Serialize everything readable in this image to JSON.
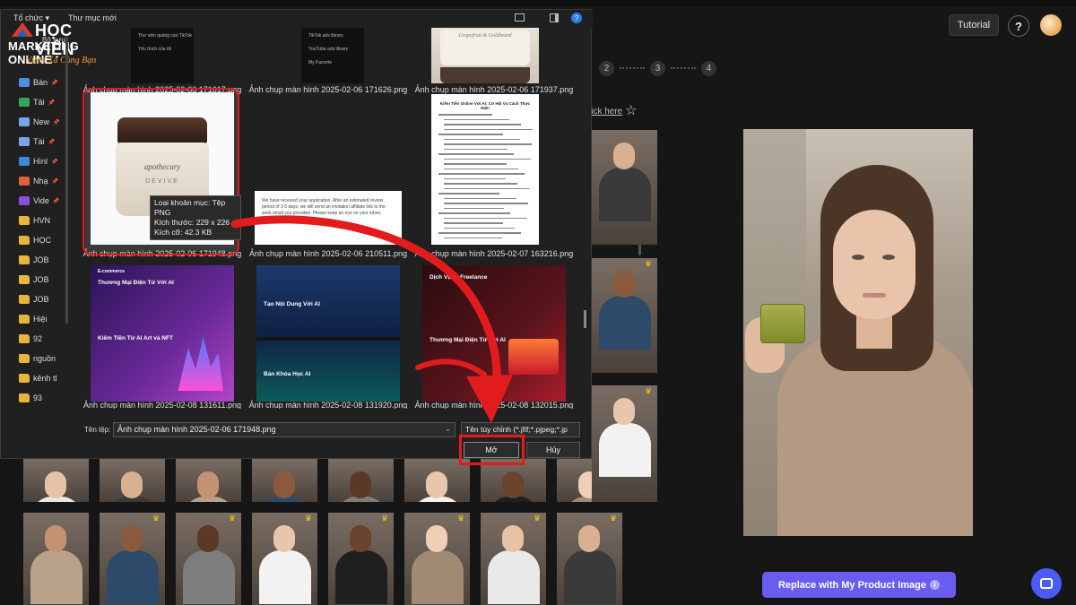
{
  "app": {
    "tutorial_label": "Tutorial",
    "help_label": "?",
    "steps": [
      "2",
      "3",
      "4"
    ],
    "click_here": "lick here",
    "replace_button": "Replace with My Product Image",
    "info_icon": "info-icon",
    "accent_color": "#6b5cf0"
  },
  "logo": {
    "hoc_vien": "HỌC VIỆN",
    "marketing": "MARKETING ONLINE",
    "slogan": "Vươn Xa Cùng Bạn",
    "sub": "Bộ sưu"
  },
  "dialog": {
    "organize": "Tổ chức ▾",
    "new_folder": "Thư mục mới",
    "nav_items": [
      {
        "label": "Bàn",
        "icon": "desktop-icon"
      },
      {
        "label": "Tải",
        "icon": "download-icon"
      },
      {
        "label": "New",
        "icon": "document-icon"
      },
      {
        "label": "Tài",
        "icon": "document-icon"
      },
      {
        "label": "Hìnl",
        "icon": "picture-icon"
      },
      {
        "label": "Nhạ",
        "icon": "music-icon"
      },
      {
        "label": "Vide",
        "icon": "video-icon"
      },
      {
        "label": "HVN",
        "icon": "folder-icon"
      },
      {
        "label": "HỌC",
        "icon": "folder-icon"
      },
      {
        "label": "JOB",
        "icon": "folder-icon"
      },
      {
        "label": "JOB",
        "icon": "folder-icon"
      },
      {
        "label": "JOB",
        "icon": "folder-icon"
      },
      {
        "label": "Hiệi",
        "icon": "folder-icon"
      },
      {
        "label": "92",
        "icon": "folder-icon"
      },
      {
        "label": "nguồn",
        "icon": "folder-icon"
      },
      {
        "label": "kênh tl",
        "icon": "folder-icon"
      },
      {
        "label": "93",
        "icon": "folder-icon"
      }
    ],
    "files": [
      {
        "name": "Ảnh chụp màn hình 2025-02-06 171617.png"
      },
      {
        "name": "Ảnh chụp màn hình 2025-02-06 171626.png"
      },
      {
        "name": "Ảnh chụp màn hình 2025-02-06 171937.png"
      },
      {
        "name": "Ảnh chụp màn hình 2025-02-06 171948.png"
      },
      {
        "name": "Ảnh chụp màn hình 2025-02-06 210511.png"
      },
      {
        "name": "Ảnh chụp màn hình 2025-02-07 163216.png"
      },
      {
        "name": "Ảnh chụp màn hình 2025-02-08 131611.png"
      },
      {
        "name": "Ảnh chụp màn hình 2025-02-08 131920.png"
      },
      {
        "name": "Ảnh chụp màn hình 2025-02-08 132015.png"
      }
    ],
    "tooltip": {
      "type": "Loại khoản mục: Tệp PNG",
      "dims": "Kích thước: 229 x 226",
      "size": "Kích cỡ: 42.3 KB"
    },
    "thumb_text": {
      "jar_brand": "apothecary",
      "jar_product": "DEVIVE",
      "jar2_brand": "Grapefruit & Goldbeard",
      "email_text": "We have received your application. After an estimated review period of 3-5 days, we will send an invitation affiliate link to the work email you provided. Please keep an eye on your inbox.",
      "doc_title": "Kiếm Tiền Online Với AI: Cơ Hội Và Cách Thực Hiện",
      "menu_items": [
        "TikTok ads library",
        "YouTube ads library",
        "My Favorite"
      ],
      "menu_items_2": [
        "Thư viện quảng cáo TikTok",
        "Yêu thích của tôi"
      ],
      "ecom_title": "Thương Mại Điện Tử Với AI",
      "ecom_sub": "E-commerce",
      "earn_title": "Kiếm Tiền Từ AI Art và NFT",
      "ai_content": "Tạo Nội Dung Với AI",
      "ai_course": "Bản Khóa Học AI",
      "ai_freelance": "Dịch Vụ AI Freelance",
      "ecom2": "Thương Mại Điện Tử Với AI"
    },
    "filename_label": "Tên tệp:",
    "filename_value": "Ảnh chụp màn hình 2025-02-06 171948.png",
    "filter_value": "Tên tùy chỉnh (*.jfif;*.pjpeg;*.jp",
    "open_label": "Mở",
    "cancel_label": "Hủy"
  },
  "colors": {
    "highlight": "#e21c1c",
    "premium": "#f2c21b",
    "folder": "#e7b53b"
  }
}
